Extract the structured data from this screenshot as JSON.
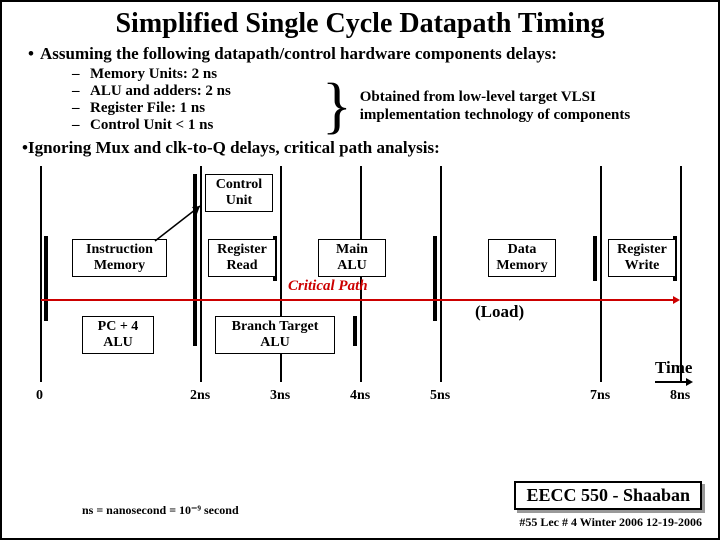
{
  "title": "Simplified Single Cycle Datapath Timing",
  "bullet1": "Assuming the following datapath/control hardware components delays:",
  "delays": [
    "Memory Units:  2 ns",
    "ALU and adders:  2 ns",
    "Register File:  1 ns",
    "Control Unit  < 1 ns"
  ],
  "brace_note_l1": "Obtained from low-level target VLSI",
  "brace_note_l2": "implementation technology of components",
  "bullet2": "Ignoring Mux and clk-to-Q delays,  critical path analysis:",
  "boxes": {
    "control_unit": "Control\nUnit",
    "instruction_memory": "Instruction\nMemory",
    "register_read": "Register\nRead",
    "main_alu": "Main\nALU",
    "data_memory": "Data\nMemory",
    "register_write": "Register\nWrite",
    "pc4_alu": "PC + 4\nALU",
    "branch_alu": "Branch Target\nALU"
  },
  "critical_path": "Critical Path",
  "load": "(Load)",
  "time": "Time",
  "ticks": [
    "0",
    "2ns",
    "3ns",
    "4ns",
    "5ns",
    "7ns",
    "8ns"
  ],
  "footnote": "ns = nanosecond = 10⁻⁹ second",
  "footer_course": "EECC 550 - Shaaban",
  "footer_meta": "#55   Lec # 4   Winter 2006   12-19-2006",
  "chart_data": {
    "type": "table",
    "title": "Single-cycle datapath stage timing (cumulative, ns)",
    "xlabel": "Time (ns)",
    "ylabel": "",
    "ylim": [
      0,
      8
    ],
    "stages": [
      {
        "name": "Instruction Memory",
        "start": 0,
        "end": 2,
        "row": "critical"
      },
      {
        "name": "Control Unit",
        "start": 2,
        "end": 3,
        "row": "control"
      },
      {
        "name": "Register Read",
        "start": 2,
        "end": 3,
        "row": "critical"
      },
      {
        "name": "PC + 4 ALU",
        "start": 0,
        "end": 2,
        "row": "pc"
      },
      {
        "name": "Main ALU",
        "start": 3,
        "end": 5,
        "row": "critical"
      },
      {
        "name": "Branch Target ALU",
        "start": 2,
        "end": 4,
        "row": "branch"
      },
      {
        "name": "Data Memory",
        "start": 5,
        "end": 7,
        "row": "critical"
      },
      {
        "name": "Register Write",
        "start": 7,
        "end": 8,
        "row": "critical"
      }
    ],
    "categories": [
      0,
      2,
      3,
      4,
      5,
      7,
      8
    ]
  }
}
